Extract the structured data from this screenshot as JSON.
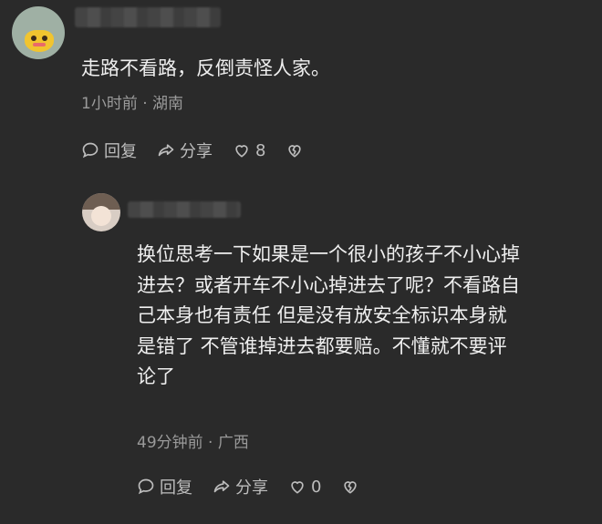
{
  "comments": [
    {
      "text": "走路不看路，反倒责怪人家。",
      "meta": "1小时前 · 湖南",
      "reply_label": "回复",
      "share_label": "分享",
      "like_count": "8"
    },
    {
      "text_lines": [
        "换位思考一下如果是一个很小的孩子不小心掉",
        "进去？或者开车不小心掉进去了呢？不看路自",
        "己本身也有责任 但是没有放安全标识本身就",
        "是错了 不管谁掉进去都要赔。不懂就不要评",
        "论了"
      ],
      "meta": "49分钟前 · 广西",
      "reply_label": "回复",
      "share_label": "分享",
      "like_count": "0"
    }
  ],
  "icons": {
    "reply": "chat-bubble-icon",
    "share": "share-arrow-icon",
    "like": "heart-icon",
    "dislike": "broken-heart-icon"
  }
}
